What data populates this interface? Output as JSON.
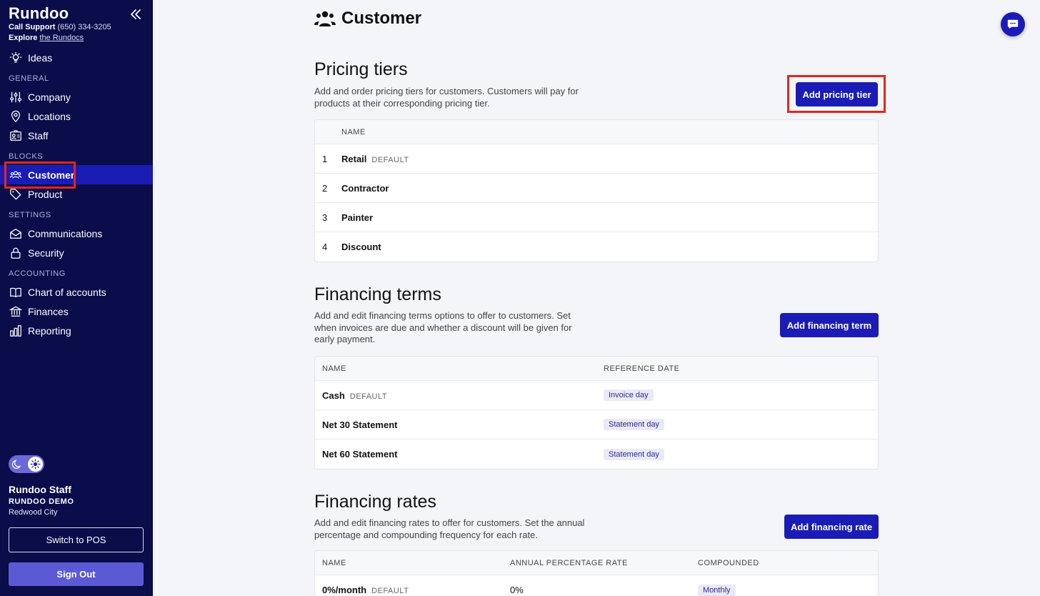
{
  "sidebar": {
    "brand": "Rundoo",
    "support_label": "Call Support",
    "support_phone": "(650) 334-3205",
    "explore_label": "Explore",
    "explore_link": "the Rundocs",
    "ideas": "Ideas",
    "sections": {
      "general": "GENERAL",
      "blocks": "BLOCKS",
      "settings": "SETTINGS",
      "accounting": "ACCOUNTING"
    },
    "items": {
      "company": "Company",
      "locations": "Locations",
      "staff": "Staff",
      "customer": "Customer",
      "product": "Product",
      "communications": "Communications",
      "security": "Security",
      "chart_of_accounts": "Chart of accounts",
      "finances": "Finances",
      "reporting": "Reporting"
    },
    "user": {
      "name": "Rundoo Staff",
      "org": "RUNDOO DEMO",
      "city": "Redwood City"
    },
    "switch_pos": "Switch to POS",
    "sign_out": "Sign Out"
  },
  "main": {
    "title": "Customer",
    "pricing": {
      "heading": "Pricing tiers",
      "description_1": "Add and order pricing tiers for customers. Customers will pay for",
      "description_2": "products at their corresponding pricing tier.",
      "add_button": "Add pricing tier",
      "col_name": "NAME",
      "rows": [
        {
          "num": "1",
          "name": "Retail",
          "tag": "DEFAULT"
        },
        {
          "num": "2",
          "name": "Contractor",
          "tag": ""
        },
        {
          "num": "3",
          "name": "Painter",
          "tag": ""
        },
        {
          "num": "4",
          "name": "Discount",
          "tag": ""
        }
      ]
    },
    "financing_terms": {
      "heading": "Financing terms",
      "description_1": "Add and edit financing terms options to offer to customers. Set",
      "description_2": "when invoices are due and whether a discount will be given for",
      "description_3": "early payment.",
      "add_button": "Add financing term",
      "col_name": "NAME",
      "col_ref": "REFERENCE DATE",
      "rows": [
        {
          "name": "Cash",
          "tag": "DEFAULT",
          "ref": "Invoice day"
        },
        {
          "name": "Net 30 Statement",
          "tag": "",
          "ref": "Statement day"
        },
        {
          "name": "Net 60 Statement",
          "tag": "",
          "ref": "Statement day"
        }
      ]
    },
    "financing_rates": {
      "heading": "Financing rates",
      "description_1": "Add and edit financing rates to offer for customers. Set the annual",
      "description_2": "percentage and compounding frequency for each rate.",
      "add_button": "Add financing rate",
      "col_name": "NAME",
      "col_apr": "ANNUAL PERCENTAGE RATE",
      "col_compounded": "COMPOUNDED",
      "rows": [
        {
          "name": "0%/month",
          "tag": "DEFAULT",
          "apr": "0%",
          "compounded": "Monthly"
        }
      ]
    }
  },
  "colors": {
    "sidebar_bg": "#0b0c4a",
    "active_item": "#1a1cb5",
    "primary_button": "#1a1cb5",
    "sign_out": "#5b59d3",
    "highlight_box": "#e3261c"
  }
}
